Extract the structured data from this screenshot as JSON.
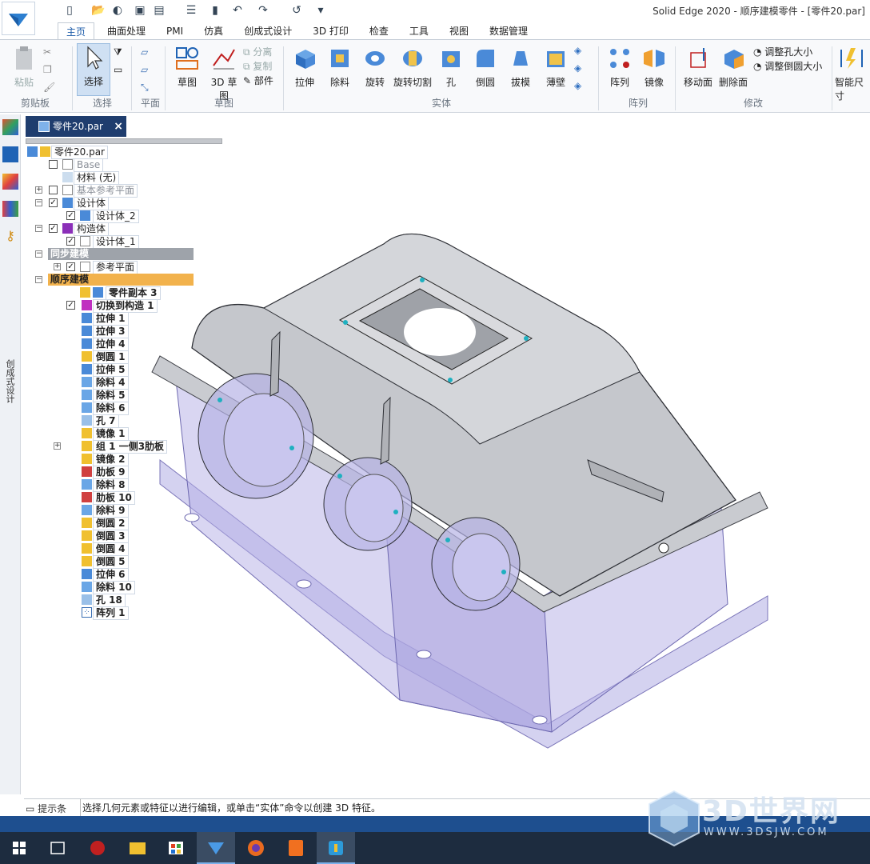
{
  "window": {
    "title": "Solid Edge 2020 - 顺序建模零件 - [零件20.par]"
  },
  "tabs": [
    "主页",
    "曲面处理",
    "PMI",
    "仿真",
    "创成式设计",
    "3D 打印",
    "检查",
    "工具",
    "视图",
    "数据管理"
  ],
  "ribbon": {
    "paste": "粘贴",
    "clipboard_group": "剪贴板",
    "select": "选择",
    "select_group": "选择",
    "plane_group": "平面",
    "sketch": "草图",
    "sketch3d": "3D 草图",
    "sketch_group": "草图",
    "split": "分离",
    "copy": "复制",
    "part": "部件",
    "extrude": "拉伸",
    "cut": "除料",
    "revolve": "旋转",
    "revolve_cut": "旋转切割",
    "hole": "孔",
    "round": "倒圆",
    "draft": "拔模",
    "thin_wall": "薄壁",
    "solid_group": "实体",
    "pattern": "阵列",
    "mirror": "镜像",
    "pattern_group": "阵列",
    "move_face": "移动面",
    "delete_face": "删除面",
    "resize_hole": "调整孔大小",
    "resize_round": "调整倒圆大小",
    "modify_group": "修改",
    "smart_dim": "智能尺寸"
  },
  "left_toolbar": {
    "vertical_label": "创成式设计"
  },
  "document_tab": "零件20.par",
  "tree": {
    "root": "零件20.par",
    "base": "Base",
    "material": "材料 (无)",
    "base_planes": "基本参考平面",
    "design_body": "设计体",
    "design_body_2": "设计体_2",
    "construction": "构造体",
    "design_body_1": "设计体_1",
    "sync": "同步建模",
    "ref_planes": "参考平面",
    "ordered": "顺序建模",
    "features": [
      "零件副本 3",
      "切换到构造 1",
      "拉伸 1",
      "拉伸 3",
      "拉伸 4",
      "倒圆 1",
      "拉伸 5",
      "除料 4",
      "除料 5",
      "除料 6",
      "孔 7",
      "镜像 1",
      "组 1 一侧3肋板",
      "镜像 2",
      "肋板 9",
      "除料 8",
      "肋板 10",
      "除料 9",
      "倒圆 2",
      "倒圆 3",
      "倒圆 4",
      "倒圆 5",
      "拉伸 6",
      "除料 10",
      "孔 18",
      "阵列 1"
    ]
  },
  "status": {
    "label": "提示条",
    "text": "选择几何元素或特征以进行编辑，或单击“实体”命令以创建 3D 特征。"
  },
  "watermark": {
    "main": "3D世界网",
    "sub": "WWW.3DSJW.COM"
  },
  "colors": {
    "accent": "#1a5aa8",
    "doc_tab": "#1f3d6e",
    "ordered_header": "#f2b24c",
    "taskbar": "#1d2c3f"
  }
}
